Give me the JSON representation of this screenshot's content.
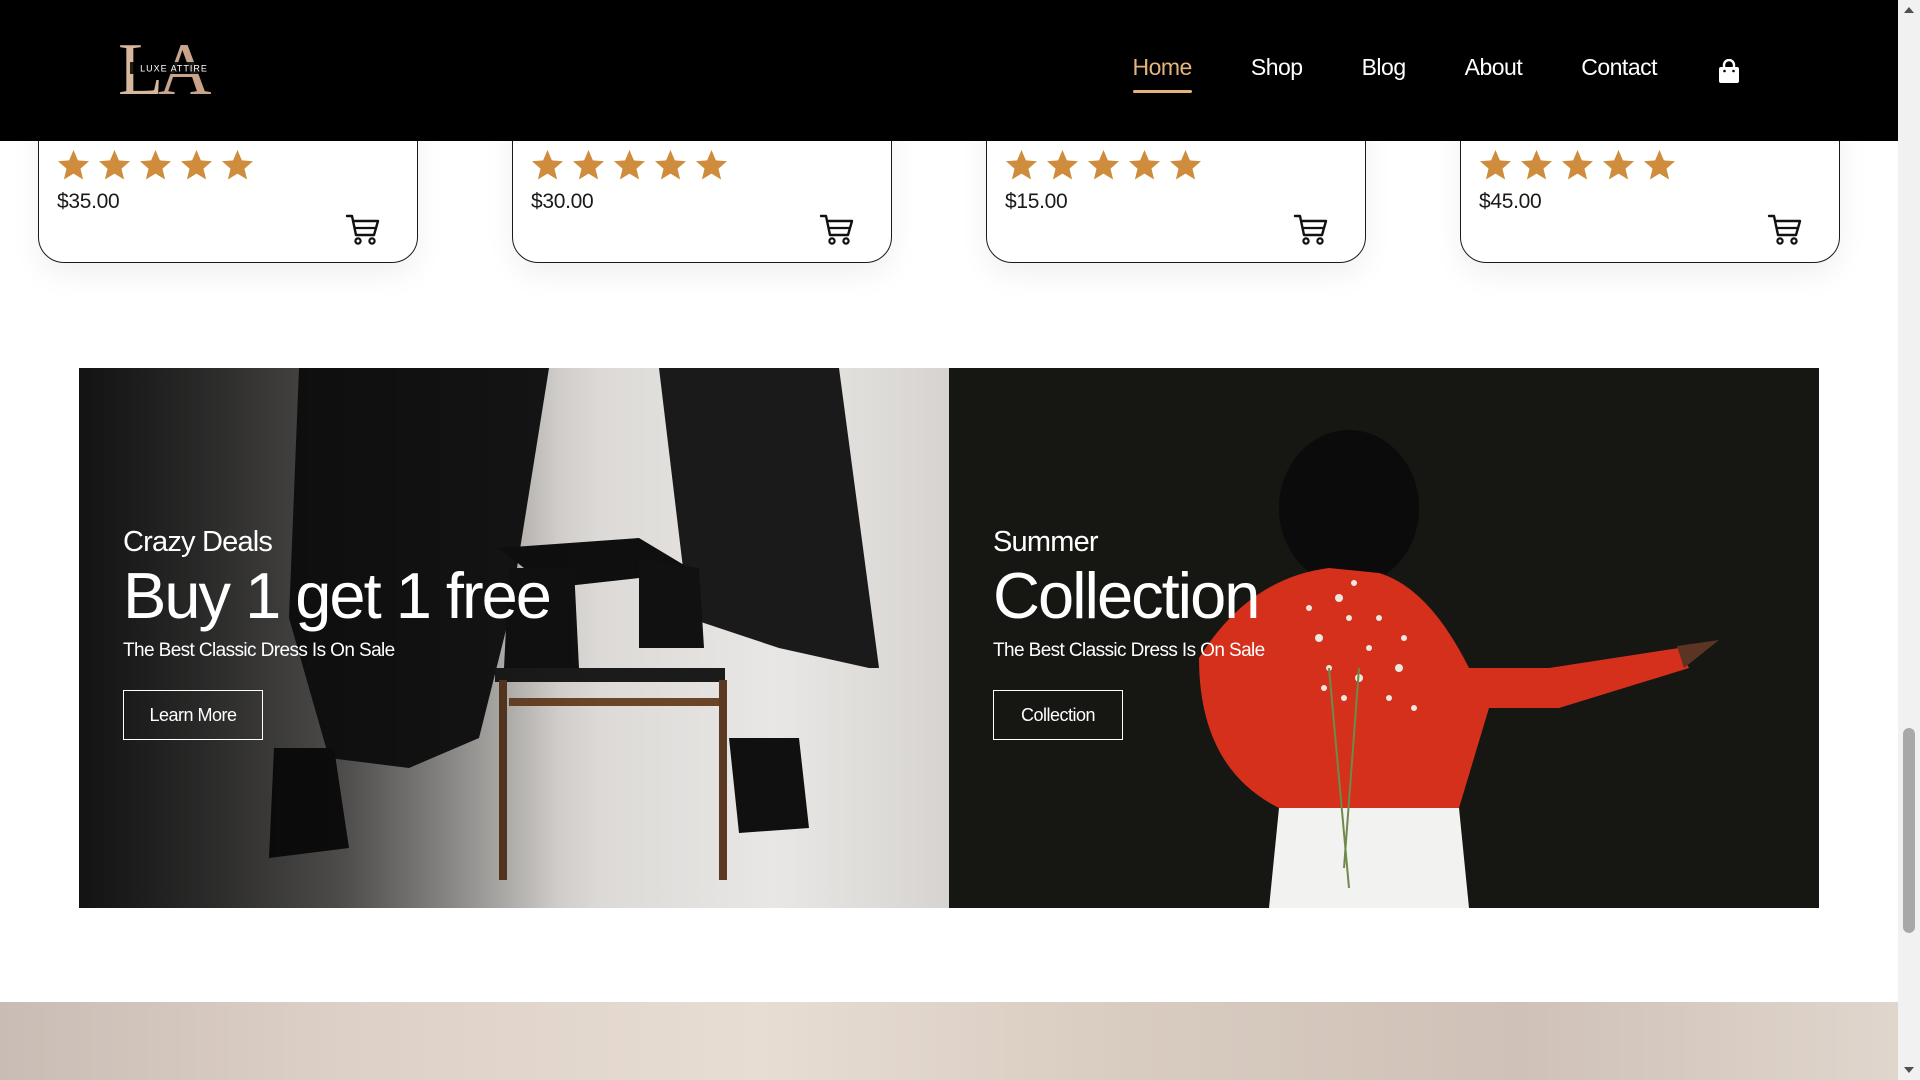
{
  "brand": {
    "logo_letters": "LA",
    "logo_text": "LUXE ATTIRE"
  },
  "nav": {
    "items": [
      {
        "label": "Home",
        "active": true
      },
      {
        "label": "Shop"
      },
      {
        "label": "Blog"
      },
      {
        "label": "About"
      },
      {
        "label": "Contact"
      }
    ],
    "cart_icon": "shopping-bag-icon"
  },
  "products": [
    {
      "price": "$35.00",
      "rating": 5
    },
    {
      "price": "$30.00",
      "rating": 5
    },
    {
      "price": "$15.00",
      "rating": 5
    },
    {
      "price": "$45.00",
      "rating": 5
    }
  ],
  "banners": [
    {
      "kicker": "Crazy Deals",
      "headline": "Buy 1 get 1 free",
      "subtitle": "The Best Classic Dress Is On Sale",
      "button": "Learn More"
    },
    {
      "kicker": "Summer",
      "headline": "Collection",
      "subtitle": "The Best Classic Dress Is On Sale",
      "button": "Collection"
    }
  ],
  "colors": {
    "header_bg": "#000000",
    "nav_active": "#e3b57c",
    "star": "#cf8c3c"
  }
}
